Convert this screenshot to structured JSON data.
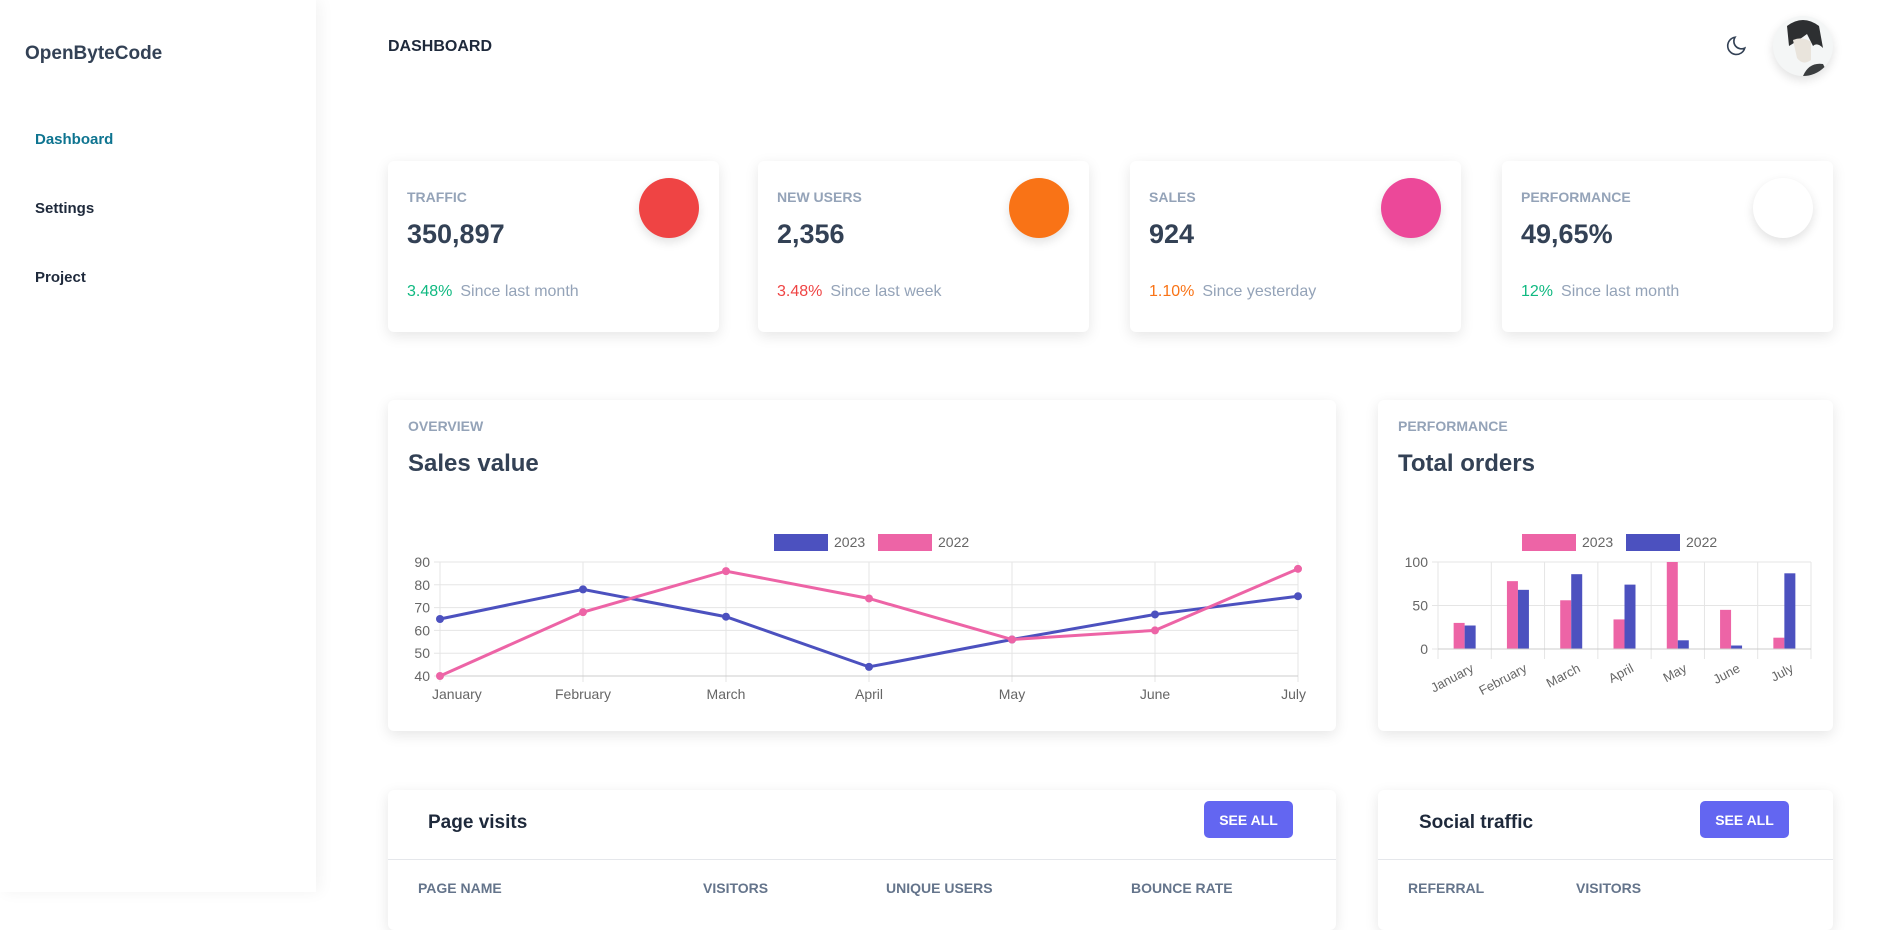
{
  "sidebar": {
    "logo": "OpenByteCode",
    "items": [
      {
        "label": "Dashboard",
        "active": true
      },
      {
        "label": "Settings"
      },
      {
        "label": "Project"
      }
    ]
  },
  "header": {
    "title": "DASHBOARD",
    "theme_icon": "moon-icon"
  },
  "stats": [
    {
      "label": "TRAFFIC",
      "value": "350,897",
      "change": "3.48%",
      "change_color": "#10b981",
      "period": "Since last month",
      "icon_color": "#ef4444"
    },
    {
      "label": "NEW USERS",
      "value": "2,356",
      "change": "3.48%",
      "change_color": "#ef4444",
      "period": "Since last week",
      "icon_color": "#f97316"
    },
    {
      "label": "SALES",
      "value": "924",
      "change": "1.10%",
      "change_color": "#f97316",
      "period": "Since yesterday",
      "icon_color": "#ec4899"
    },
    {
      "label": "PERFORMANCE",
      "value": "49,65%",
      "change": "12%",
      "change_color": "#10b981",
      "period": "Since last month",
      "icon_color": "#ffffff"
    }
  ],
  "overview": {
    "label": "OVERVIEW",
    "title": "Sales value"
  },
  "performance": {
    "label": "PERFORMANCE",
    "title": "Total orders"
  },
  "chart_data": [
    {
      "type": "line",
      "categories": [
        "January",
        "February",
        "March",
        "April",
        "May",
        "June",
        "July"
      ],
      "ylim": [
        40,
        90
      ],
      "yticks": [
        40,
        50,
        60,
        70,
        80,
        90
      ],
      "grid": true,
      "legend": "top",
      "series": [
        {
          "name": "2023",
          "color": "#4c51bf",
          "values": [
            65,
            78,
            66,
            44,
            56,
            67,
            75
          ]
        },
        {
          "name": "2022",
          "color": "#ed64a6",
          "values": [
            40,
            68,
            86,
            74,
            56,
            60,
            87
          ]
        }
      ]
    },
    {
      "type": "bar",
      "categories": [
        "January",
        "February",
        "March",
        "April",
        "May",
        "June",
        "July"
      ],
      "ylim": [
        0,
        100
      ],
      "yticks": [
        0,
        50,
        100
      ],
      "grid": true,
      "legend": "top",
      "series": [
        {
          "name": "2023",
          "color": "#ed64a6",
          "values": [
            30,
            78,
            56,
            34,
            100,
            45,
            13
          ]
        },
        {
          "name": "2022",
          "color": "#4c51bf",
          "values": [
            27,
            68,
            86,
            74,
            10,
            4,
            87
          ]
        }
      ]
    }
  ],
  "page_visits": {
    "title": "Page visits",
    "button": "SEE ALL",
    "columns": [
      "PAGE NAME",
      "VISITORS",
      "UNIQUE USERS",
      "BOUNCE RATE"
    ]
  },
  "social_traffic": {
    "title": "Social traffic",
    "button": "SEE ALL",
    "columns": [
      "REFERRAL",
      "VISITORS"
    ]
  }
}
